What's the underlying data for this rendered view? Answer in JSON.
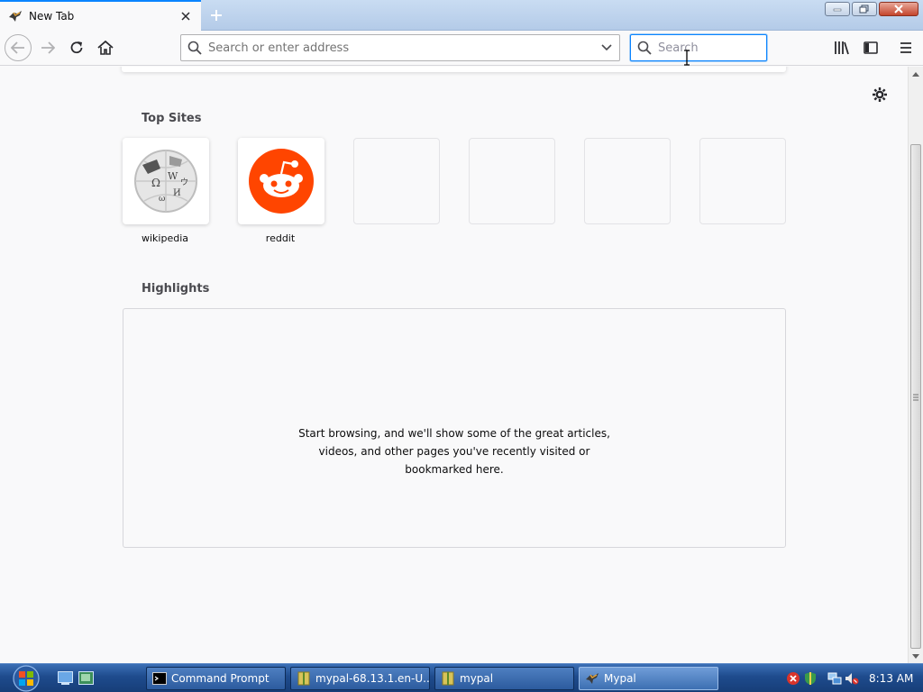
{
  "tab": {
    "title": "New Tab",
    "favicon": "mypal-icon",
    "close_icon": "close-icon"
  },
  "new_tab_icon": "plus-icon",
  "window_buttons": [
    "minimize-icon",
    "restore-icon",
    "close-icon"
  ],
  "navigation": {
    "back_icon": "back-arrow-icon",
    "forward_icon": "forward-arrow-icon",
    "reload_icon": "reload-icon",
    "home_icon": "home-icon",
    "url_placeholder": "Search or enter address",
    "url_value": "",
    "search_placeholder": "Search",
    "search_value": "",
    "library_icon": "library-icon",
    "sidebar_icon": "sidebar-icon",
    "menu_icon": "hamburger-menu-icon"
  },
  "newtab": {
    "settings_icon": "gear-icon",
    "top_sites_title": "Top Sites",
    "top_sites": [
      {
        "label": "wikipedia",
        "icon": "wikipedia-globe-icon"
      },
      {
        "label": "reddit",
        "icon": "reddit-icon"
      },
      {
        "label": "",
        "icon": ""
      },
      {
        "label": "",
        "icon": ""
      },
      {
        "label": "",
        "icon": ""
      },
      {
        "label": "",
        "icon": ""
      }
    ],
    "highlights_title": "Highlights",
    "highlights_message": "Start browsing, and we'll show some of the great articles, videos, and other pages you've recently visited or bookmarked here."
  },
  "taskbar": {
    "tasks": [
      {
        "label": "Command Prompt",
        "icon": "cmd-icon"
      },
      {
        "label": "mypal-68.13.1.en-U...",
        "icon": "archive-icon"
      },
      {
        "label": "mypal",
        "icon": "archive-icon"
      },
      {
        "label": "Mypal",
        "icon": "mypal-icon"
      }
    ],
    "clock": "8:13 AM"
  },
  "colors": {
    "accent": "#0a84ff",
    "reddit": "#ff4500",
    "taskbar": "#1e4b8d"
  }
}
